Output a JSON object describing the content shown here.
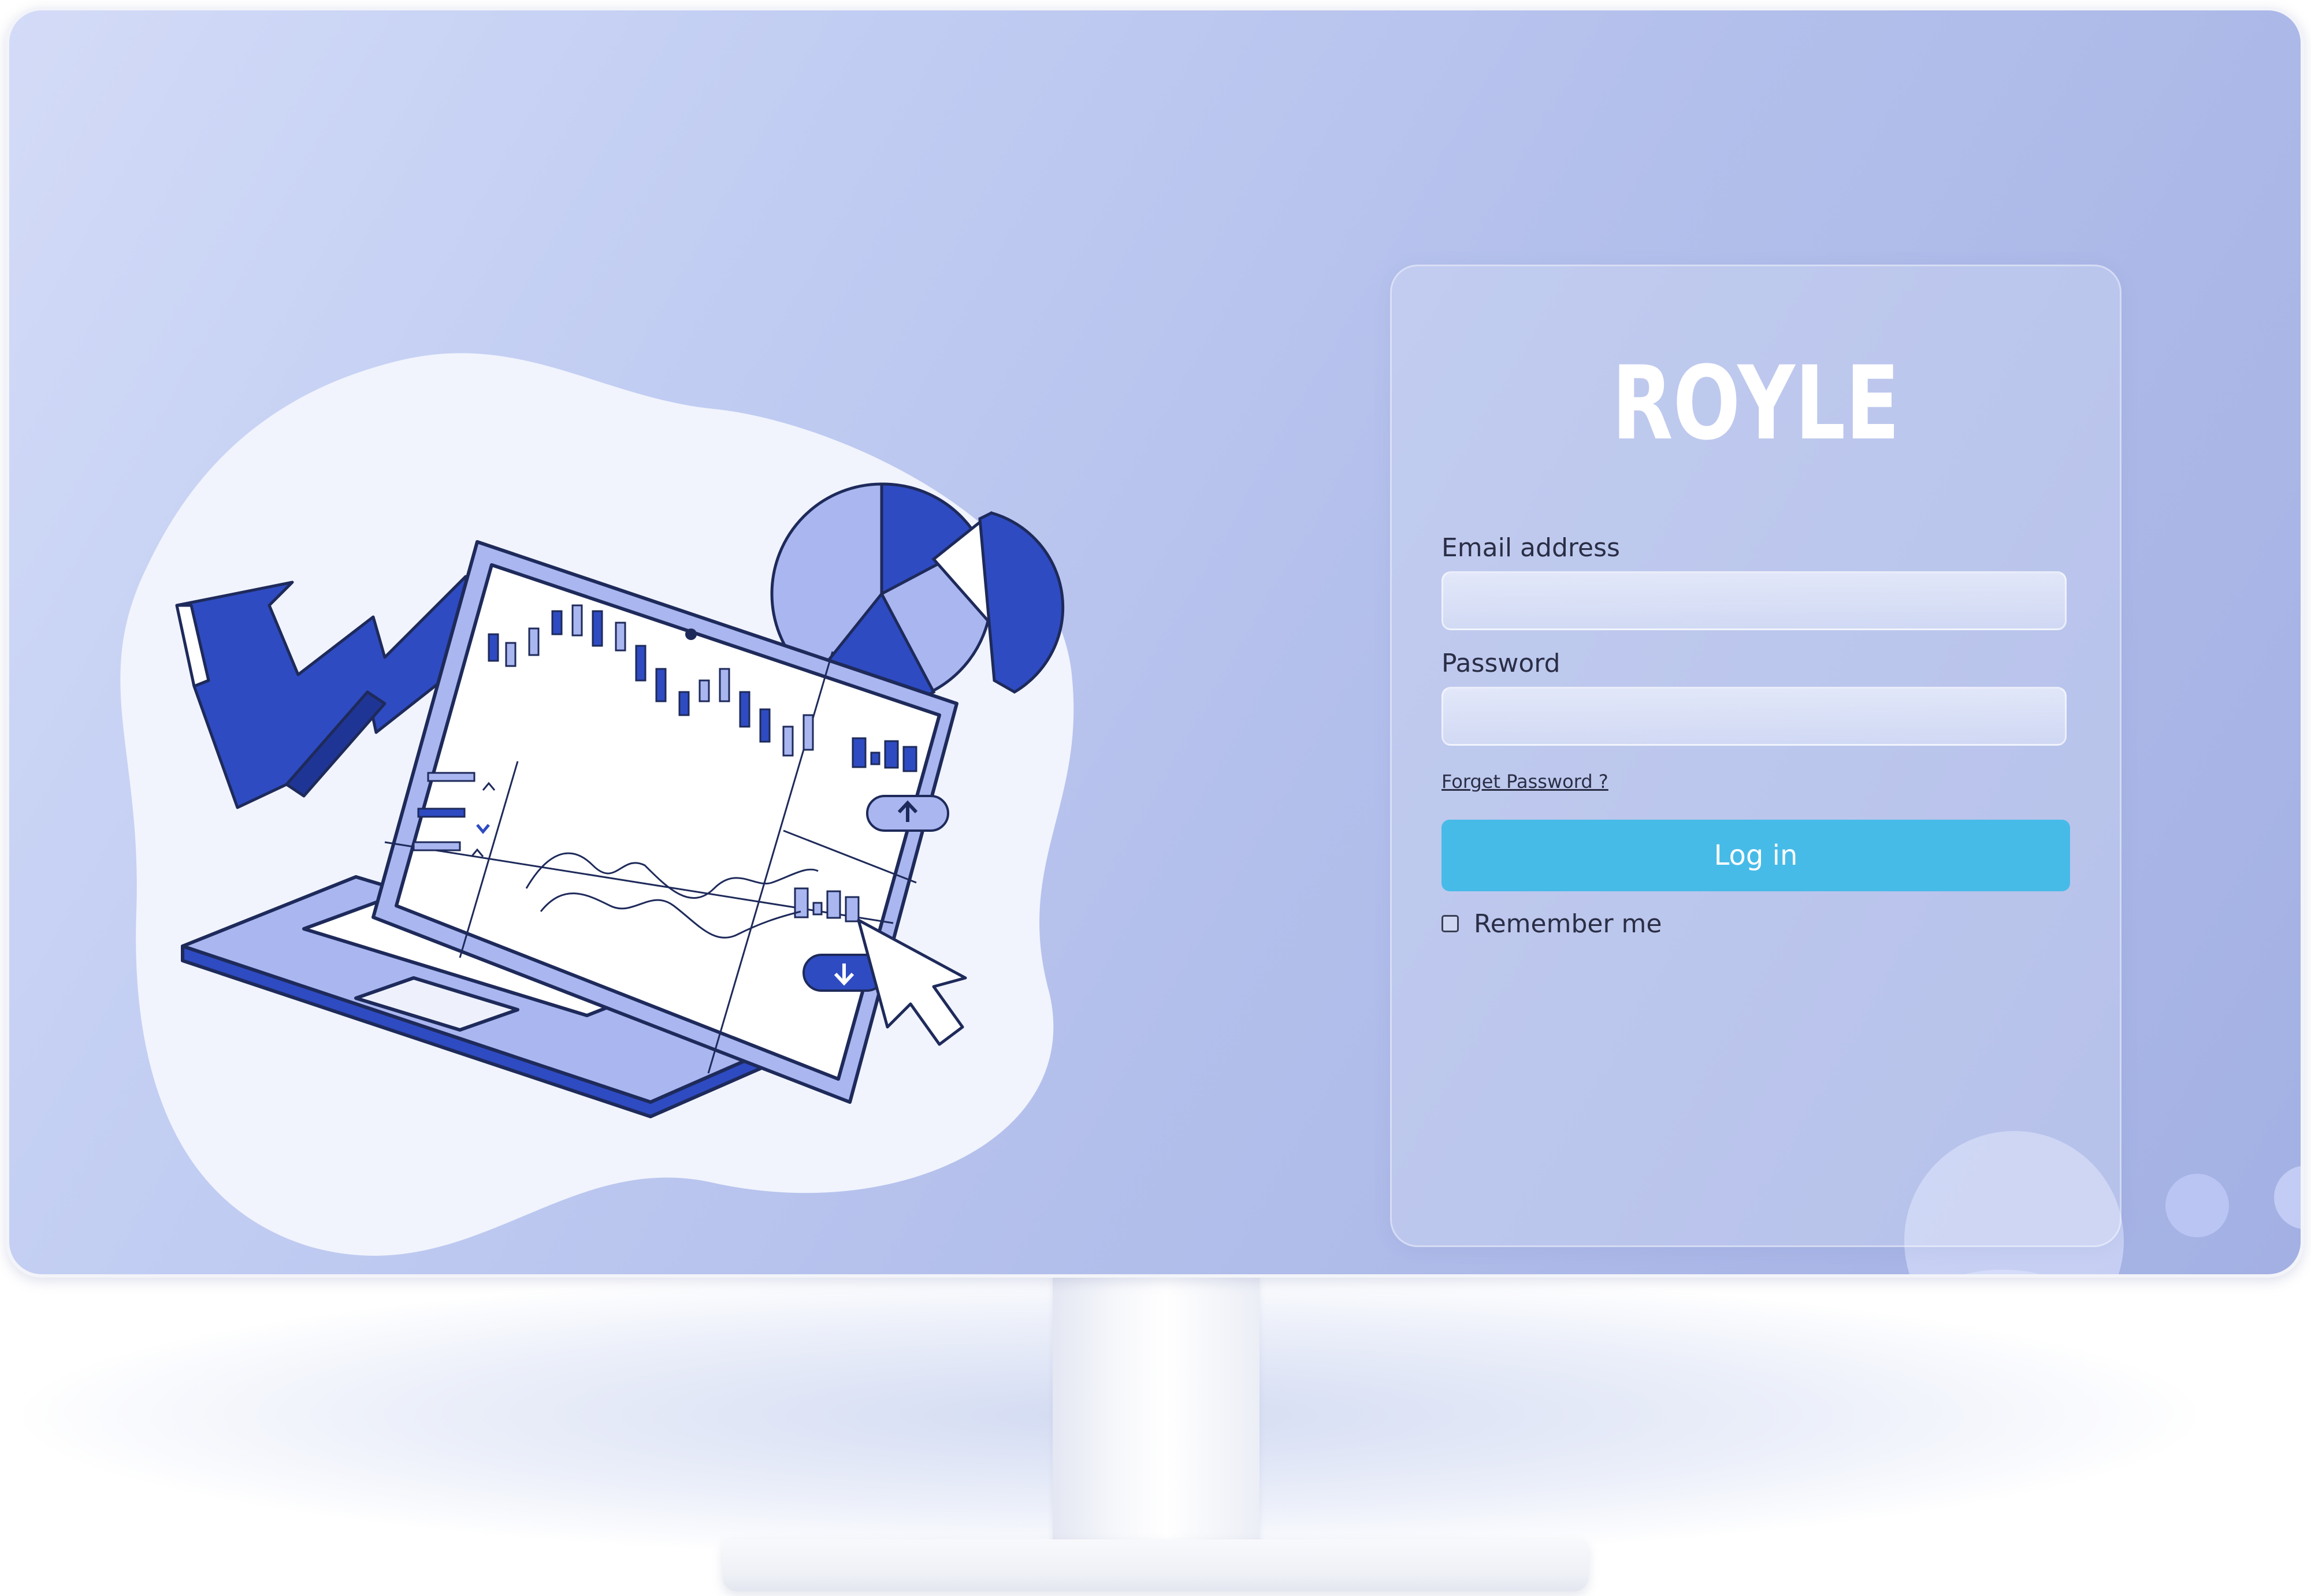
{
  "brand": {
    "logo_text": "ROYLE"
  },
  "login": {
    "email_label": "Email address",
    "email_value": "",
    "password_label": "Password",
    "password_value": "",
    "forgot_password": "Forget Password ?",
    "submit_label": "Log in",
    "remember_label": "Remember me",
    "remember_checked": false
  },
  "colors": {
    "accent": "#47bbe8",
    "illustration_primary": "#3a57c7",
    "illustration_light": "#a9b6f0"
  },
  "illustration": {
    "icons": [
      "trend-arrow-icon",
      "pie-chart-icon",
      "laptop-icon",
      "cursor-icon",
      "up-arrow-icon",
      "down-arrow-icon"
    ]
  }
}
